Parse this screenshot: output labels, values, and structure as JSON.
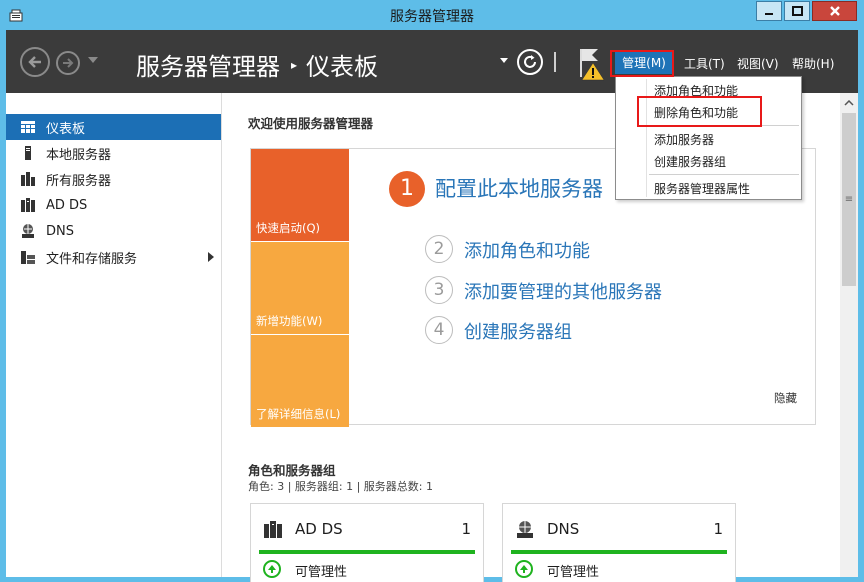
{
  "window": {
    "title": "服务器管理器"
  },
  "header": {
    "breadcrumb_root": "服务器管理器",
    "breadcrumb_separator": "▸",
    "breadcrumb_current": "仪表板",
    "menus": {
      "manage": "管理(M)",
      "tools": "工具(T)",
      "view": "视图(V)",
      "help": "帮助(H)"
    }
  },
  "manage_menu": {
    "items": [
      "添加角色和功能",
      "删除角色和功能",
      "添加服务器",
      "创建服务器组",
      "服务器管理器属性"
    ]
  },
  "sidebar": {
    "items": [
      {
        "label": "仪表板",
        "icon": "dashboard-icon",
        "selected": true
      },
      {
        "label": "本地服务器",
        "icon": "local-server-icon"
      },
      {
        "label": "所有服务器",
        "icon": "all-servers-icon"
      },
      {
        "label": "AD DS",
        "icon": "ad-ds-icon"
      },
      {
        "label": "DNS",
        "icon": "dns-icon"
      },
      {
        "label": "文件和存储服务",
        "icon": "file-storage-icon",
        "expandable": true
      }
    ]
  },
  "main": {
    "welcome_title": "欢迎使用服务器管理器",
    "quick_start": {
      "tiles": [
        "快速启动(Q)",
        "新增功能(W)",
        "了解详细信息(L)"
      ],
      "steps": [
        {
          "num": "1",
          "label": "配置此本地服务器"
        },
        {
          "num": "2",
          "label": "添加角色和功能"
        },
        {
          "num": "3",
          "label": "添加要管理的其他服务器"
        },
        {
          "num": "4",
          "label": "创建服务器组"
        }
      ],
      "hide": "隐藏"
    },
    "roles": {
      "title": "角色和服务器组",
      "summary": "角色: 3 | 服务器组: 1 | 服务器总数: 1",
      "cards": [
        {
          "name": "AD DS",
          "count": "1",
          "status": "可管理性"
        },
        {
          "name": "DNS",
          "count": "1",
          "status": "可管理性"
        }
      ]
    }
  },
  "colors": {
    "title_bar": "#5ebde8",
    "header_bg": "#3b3b3b",
    "accent_blue": "#1c6fb5",
    "tile_orange": "#e8612a",
    "tile_amber": "#f7a840",
    "status_green": "#1fb31f",
    "highlight_red": "#e81919"
  }
}
